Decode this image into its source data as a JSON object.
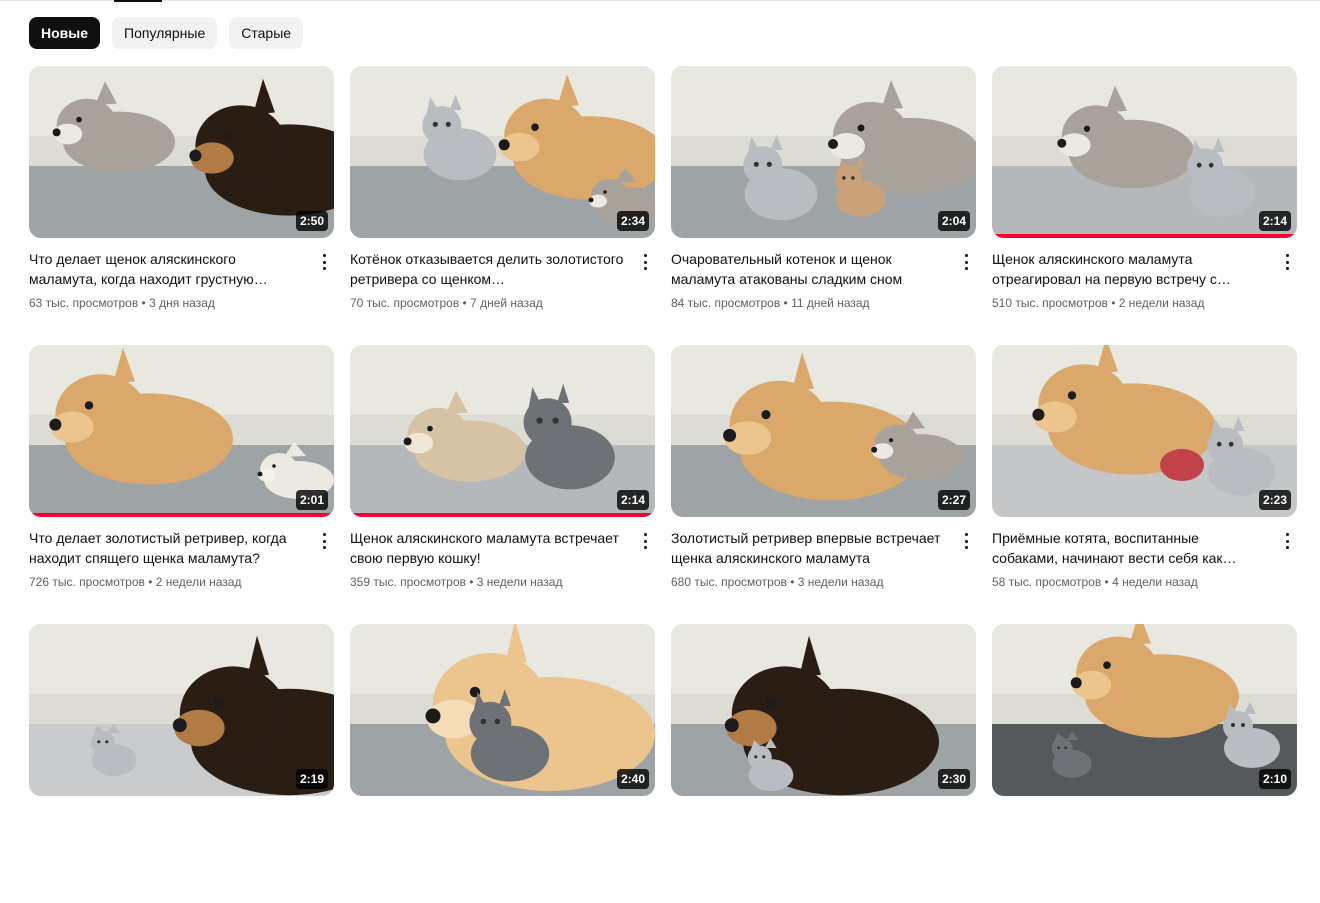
{
  "filters": [
    {
      "label": "Новые",
      "active": true
    },
    {
      "label": "Популярные",
      "active": false
    },
    {
      "label": "Старые",
      "active": false
    }
  ],
  "videos": [
    {
      "title": "Что делает щенок аляскинского маламута, когда находит грустную…",
      "views": "63 тыс. просмотров",
      "age": "3 дня назад",
      "duration": "2:50",
      "watched": 0,
      "scene": "husky-shepherd"
    },
    {
      "title": "Котёнок отказывается делить золотистого ретривера со щенком…",
      "views": "70 тыс. просмотров",
      "age": "7 дней назад",
      "duration": "2:34",
      "watched": 0,
      "scene": "kitten-retriever-puppy"
    },
    {
      "title": "Очаровательный котенок и щенок маламута атакованы сладким сном",
      "views": "84 тыс. просмотров",
      "age": "11 дней назад",
      "duration": "2:04",
      "watched": 0,
      "scene": "sleeping-kittens-puppy"
    },
    {
      "title": "Щенок аляскинского маламута отреагировал на первую встречу с…",
      "views": "510 тыс. просмотров",
      "age": "2 недели назад",
      "duration": "2:14",
      "watched": 1.0,
      "scene": "puppy-meets-kitten"
    },
    {
      "title": "Что делает золотистый ретривер, когда находит спящего щенка маламута?",
      "views": "726 тыс. просмотров",
      "age": "2 недели назад",
      "duration": "2:01",
      "watched": 1.0,
      "scene": "retriever-sleeping-puppy"
    },
    {
      "title": "Щенок аляскинского маламута встречает свою первую кошку!",
      "views": "359 тыс. просмотров",
      "age": "3 недели назад",
      "duration": "2:14",
      "watched": 1.0,
      "scene": "puppy-tabby-cat"
    },
    {
      "title": "Золотистый ретривер впервые встречает щенка аляскинского маламута",
      "views": "680 тыс. просмотров",
      "age": "3 недели назад",
      "duration": "2:27",
      "watched": 0,
      "scene": "retriever-nose-puppy"
    },
    {
      "title": "Приёмные котята, воспитанные собаками, начинают вести себя как…",
      "views": "58 тыс. просмотров",
      "age": "4 недели назад",
      "duration": "2:23",
      "watched": 0,
      "scene": "retriever-kittens-bone"
    },
    {
      "title": "",
      "views": "",
      "age": "",
      "duration": "2:19",
      "watched": 0,
      "scene": "shepherd-tiny-kitten"
    },
    {
      "title": "",
      "views": "",
      "age": "",
      "duration": "2:40",
      "watched": 0,
      "scene": "retriever-hugging-kitten"
    },
    {
      "title": "",
      "views": "",
      "age": "",
      "duration": "2:30",
      "watched": 0,
      "scene": "shepherd-with-kitten"
    },
    {
      "title": "",
      "views": "",
      "age": "",
      "duration": "2:10",
      "watched": 0,
      "scene": "retriever-bed-kittens"
    }
  ],
  "colors": {
    "accent": "#ff0033",
    "chip_active_bg": "#0f0f0f",
    "chip_bg": "#f2f2f2",
    "meta_text": "#606060"
  }
}
